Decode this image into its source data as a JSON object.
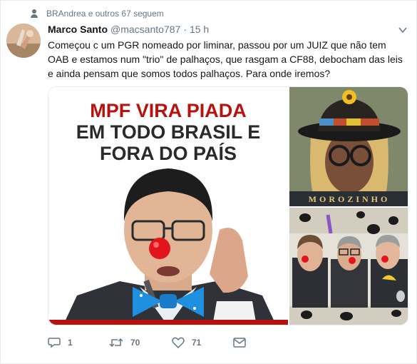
{
  "social_context": "BRAndrea e outros 67 seguem",
  "author": {
    "name": "Marco Santo",
    "handle": "@macsanto787",
    "separator": "·",
    "time": "15 h"
  },
  "tweet_text": "Começou c um PGR nomeado por liminar, passou por um JUIZ que não tem OAB e estamos num \"trio\" de palhaços, que rasgam a CF88, debocham das leis e ainda pensam que somos todos palhaços. Para onde iremos?",
  "media": {
    "main_headline": [
      "MPF VIRA PIADA",
      "EM TODO BRASIL E",
      "FORA DO PAÍS"
    ],
    "top_right_caption": "MOROZINHO"
  },
  "actions": {
    "reply_count": "1",
    "retweet_count": "70",
    "like_count": "71"
  },
  "colors": {
    "text": "#14171a",
    "secondary": "#657786",
    "headline_red": "#b8120e",
    "headline_dark": "#2a2a2a",
    "clown_nose": "#e4141c",
    "bow_tie": "#1f8fe0"
  },
  "icons": [
    "person-icon",
    "caret-down-icon",
    "reply-icon",
    "retweet-icon",
    "like-icon",
    "dm-icon"
  ]
}
